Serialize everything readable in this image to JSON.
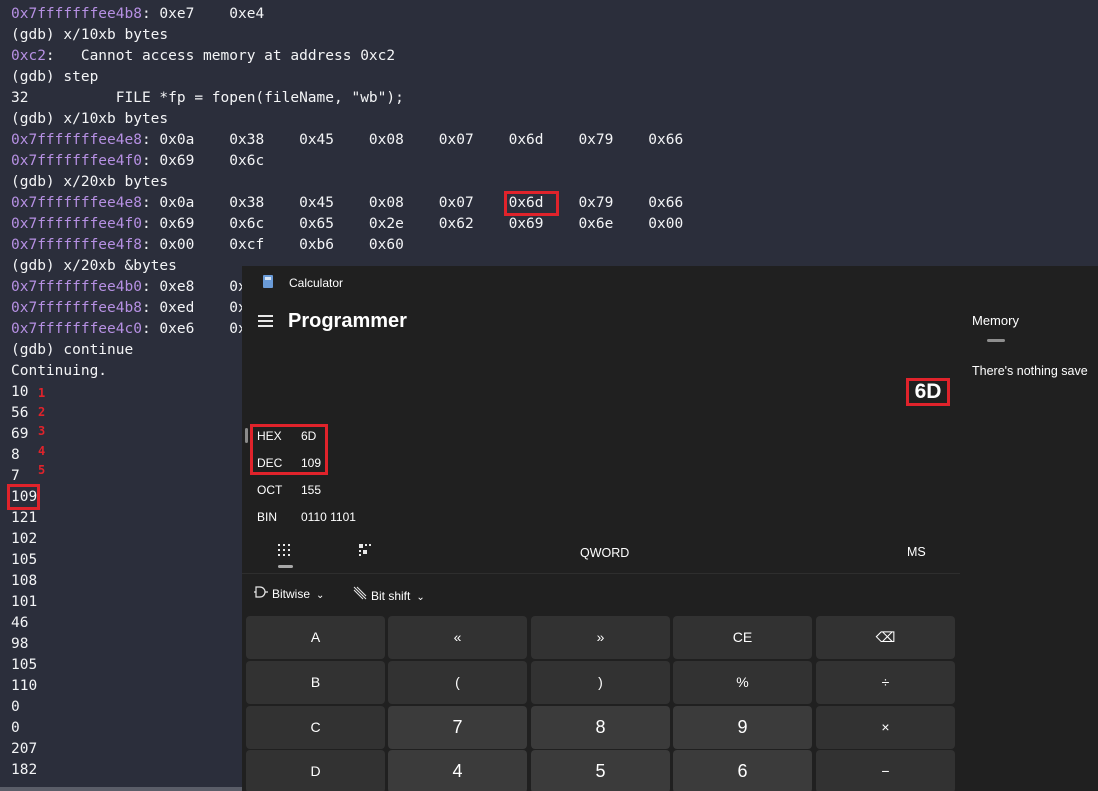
{
  "terminal": {
    "lines": [
      {
        "addr": "0x7fffffffee4b8",
        "text": ": 0xe7    0xe4"
      },
      {
        "addr": "",
        "text": "(gdb) x/10xb bytes"
      },
      {
        "addr": "0xc2",
        "text": ":   Cannot access memory at address 0xc2"
      },
      {
        "addr": "",
        "text": "(gdb) step"
      },
      {
        "addr": "",
        "text": "32          FILE *fp = fopen(fileName, \"wb\");"
      },
      {
        "addr": "",
        "text": "(gdb) x/10xb bytes"
      },
      {
        "addr": "0x7fffffffee4e8",
        "text": ": 0x0a    0x38    0x45    0x08    0x07    0x6d    0x79    0x66"
      },
      {
        "addr": "0x7fffffffee4f0",
        "text": ": 0x69    0x6c"
      },
      {
        "addr": "",
        "text": "(gdb) x/20xb bytes"
      },
      {
        "addr": "0x7fffffffee4e8",
        "text": ": 0x0a    0x38    0x45    0x08    0x07    0x6d    0x79    0x66"
      },
      {
        "addr": "0x7fffffffee4f0",
        "text": ": 0x69    0x6c    0x65    0x2e    0x62    0x69    0x6e    0x00"
      },
      {
        "addr": "0x7fffffffee4f8",
        "text": ": 0x00    0xcf    0xb6    0x60"
      },
      {
        "addr": "",
        "text": "(gdb) x/20xb &bytes"
      },
      {
        "addr": "0x7fffffffee4b0",
        "text": ": 0xe8    0x"
      },
      {
        "addr": "0x7fffffffee4b8",
        "text": ": 0xed    0x"
      },
      {
        "addr": "0x7fffffffee4c0",
        "text": ": 0xe6    0x"
      },
      {
        "addr": "",
        "text": "(gdb) continue"
      },
      {
        "addr": "",
        "text": "Continuing."
      },
      {
        "addr": "",
        "text": "10"
      },
      {
        "addr": "",
        "text": "56"
      },
      {
        "addr": "",
        "text": "69"
      },
      {
        "addr": "",
        "text": "8"
      },
      {
        "addr": "",
        "text": "7"
      },
      {
        "addr": "",
        "text": "109"
      },
      {
        "addr": "",
        "text": "121"
      },
      {
        "addr": "",
        "text": "102"
      },
      {
        "addr": "",
        "text": "105"
      },
      {
        "addr": "",
        "text": "108"
      },
      {
        "addr": "",
        "text": "101"
      },
      {
        "addr": "",
        "text": "46"
      },
      {
        "addr": "",
        "text": "98"
      },
      {
        "addr": "",
        "text": "105"
      },
      {
        "addr": "",
        "text": "110"
      },
      {
        "addr": "",
        "text": "0"
      },
      {
        "addr": "",
        "text": "0"
      },
      {
        "addr": "",
        "text": "207"
      },
      {
        "addr": "",
        "text": "182"
      }
    ],
    "annotations": [
      "1",
      "2",
      "3",
      "4",
      "5"
    ]
  },
  "calculator": {
    "app_title": "Calculator",
    "mode": "Programmer",
    "display": "6D",
    "radix": [
      {
        "label": "HEX",
        "value": "6D"
      },
      {
        "label": "DEC",
        "value": "109"
      },
      {
        "label": "OCT",
        "value": "155"
      },
      {
        "label": "BIN",
        "value": "0110 1101"
      }
    ],
    "word_size": "QWORD",
    "memory_store": "MS",
    "bitwise": "Bitwise",
    "bitshift": "Bit shift",
    "keys": [
      [
        "A",
        "«",
        "»",
        "CE",
        "⌫"
      ],
      [
        "B",
        "(",
        ")",
        "%",
        "÷"
      ],
      [
        "C",
        "7",
        "8",
        "9",
        "×"
      ],
      [
        "D",
        "4",
        "5",
        "6",
        "−"
      ]
    ],
    "memory": {
      "title": "Memory",
      "empty_text": "There's nothing save"
    }
  }
}
